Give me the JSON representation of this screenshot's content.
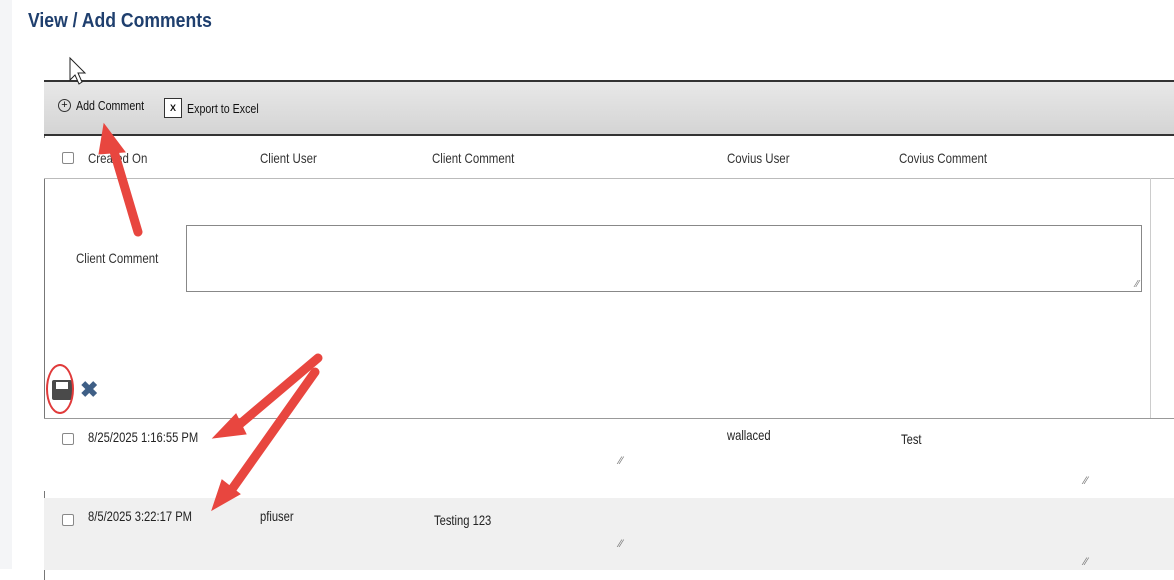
{
  "page": {
    "title": "View / Add Comments"
  },
  "toolbar": {
    "add_comment_label": "Add Comment",
    "export_label": "Export to Excel",
    "add_icon": "plus-circle-icon",
    "export_icon": "excel-icon"
  },
  "columns": [
    "Created On",
    "Client User",
    "Client Comment",
    "Covius User",
    "Covius Comment"
  ],
  "editor": {
    "label": "Client Comment",
    "value": "",
    "save_icon": "floppy-disk-icon",
    "cancel_icon": "x-icon"
  },
  "rows": [
    {
      "created_on": "8/25/2025 1:16:55 PM",
      "client_user": "",
      "client_comment": "",
      "covius_user": "wallaced",
      "covius_comment": "Test"
    },
    {
      "created_on": "8/5/2025 3:22:17 PM",
      "client_user": "pfiuser",
      "client_comment": "Testing 123",
      "covius_user": "",
      "covius_comment": ""
    }
  ],
  "colors": {
    "title": "#1f3f6e",
    "annotation": "#e03a3a",
    "alt_row": "#f0f0f0"
  }
}
